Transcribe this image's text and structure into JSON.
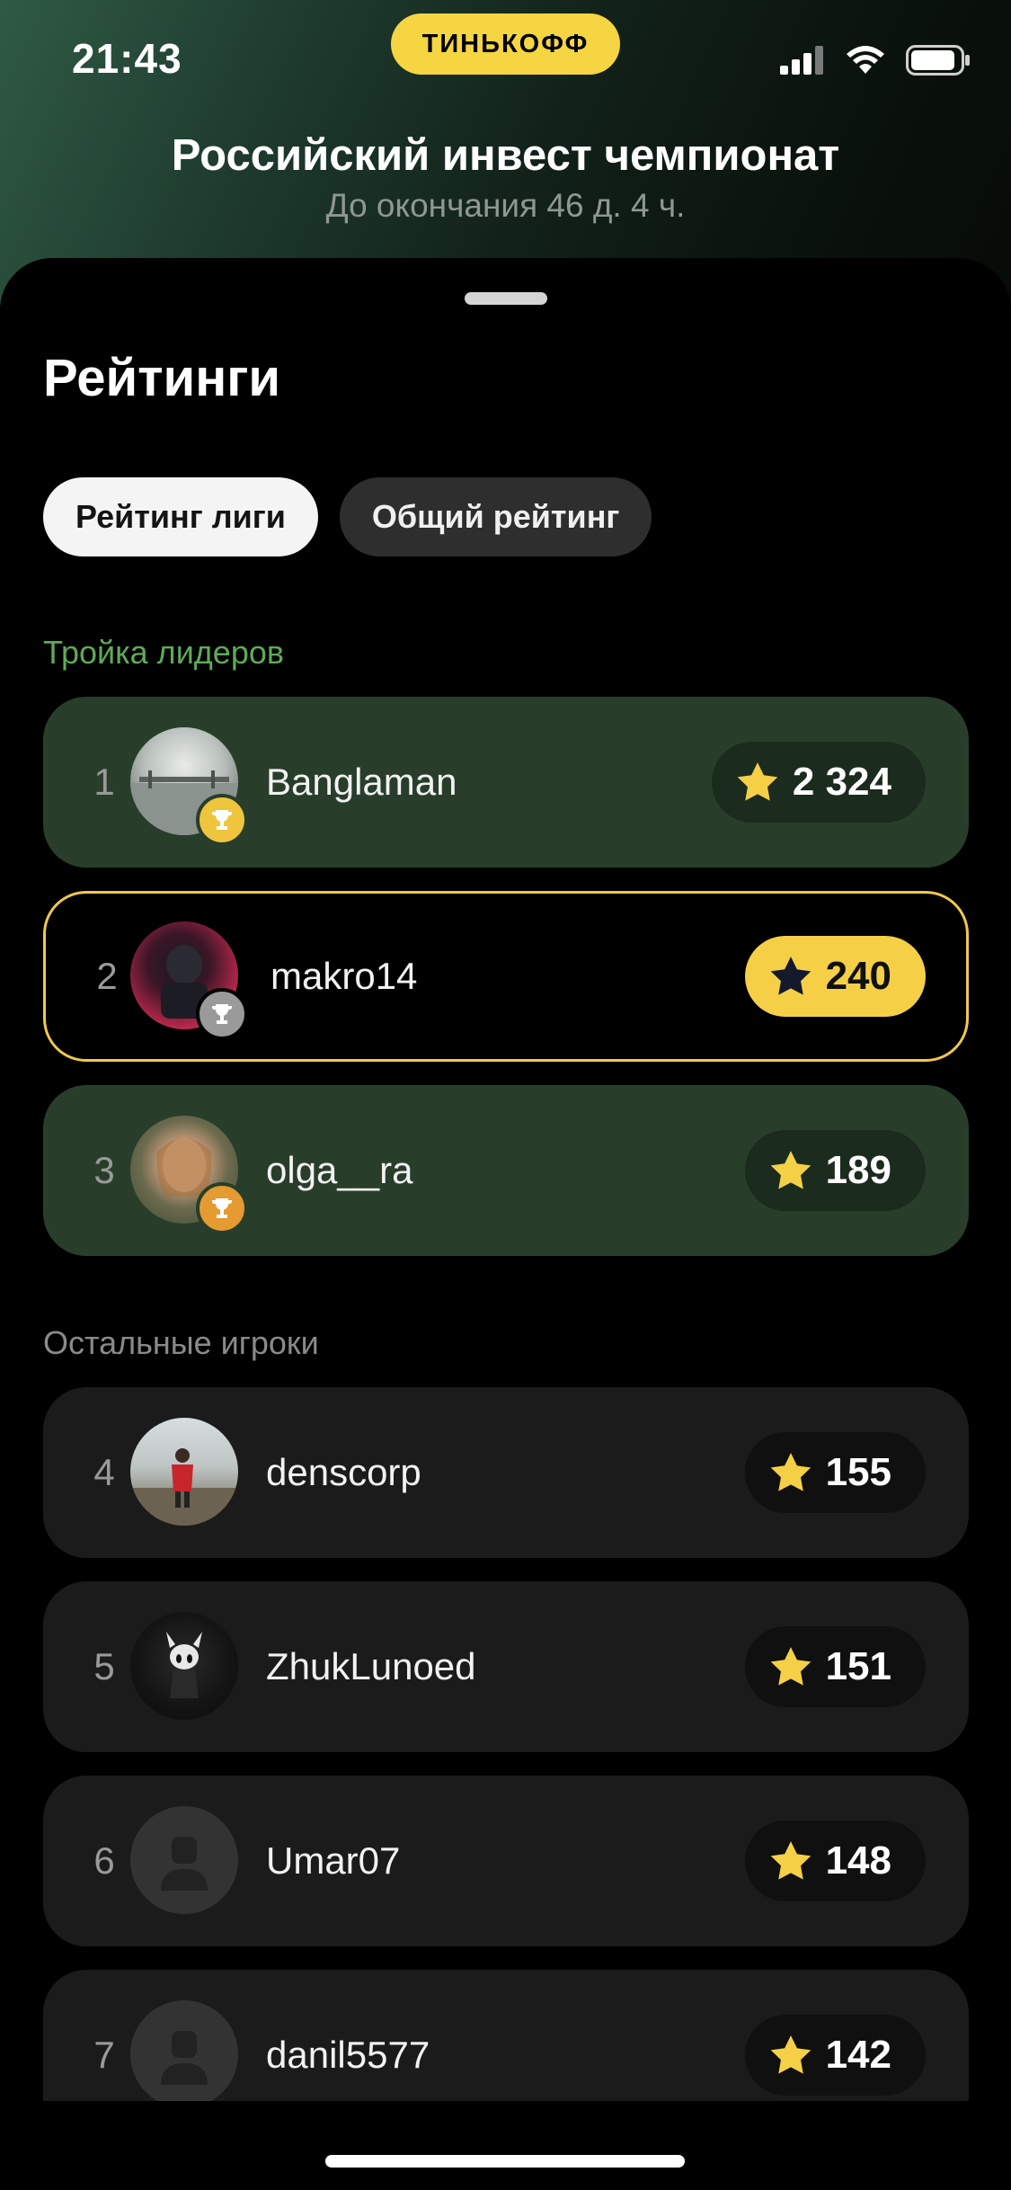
{
  "status_bar": {
    "time": "21:43",
    "brand": "ТИНЬКОФФ"
  },
  "header": {
    "title": "Российский инвест чемпионат",
    "subtitle": "До окончания 46 д. 4 ч."
  },
  "sheet": {
    "title": "Рейтинги",
    "tabs": [
      {
        "label": "Рейтинг лиги",
        "active": true
      },
      {
        "label": "Общий рейтинг",
        "active": false
      }
    ],
    "top_section_title": "Тройка лидеров",
    "rest_section_title": "Остальные игроки"
  },
  "leaders": [
    {
      "rank": "1",
      "name": "Banglaman",
      "score": "2 324",
      "medal": "gold"
    },
    {
      "rank": "2",
      "name": "makro14",
      "score": "240",
      "medal": "silver",
      "current_user": true
    },
    {
      "rank": "3",
      "name": "olga__ra",
      "score": "189",
      "medal": "bronze"
    }
  ],
  "players": [
    {
      "rank": "4",
      "name": "denscorp",
      "score": "155"
    },
    {
      "rank": "5",
      "name": "ZhukLunoed",
      "score": "151"
    },
    {
      "rank": "6",
      "name": "Umar07",
      "score": "148",
      "avatar": "placeholder"
    },
    {
      "rank": "7",
      "name": "danil5577",
      "score": "142",
      "avatar": "placeholder"
    }
  ],
  "icons": {
    "score": "star-icon",
    "medal": "trophy-icon",
    "placeholder_avatar": "user-icon"
  },
  "colors": {
    "brand_yellow": "#f5d541",
    "leader_row": "#283e2a",
    "section_green": "#5faa58",
    "highlight_border": "#f1c84d"
  }
}
